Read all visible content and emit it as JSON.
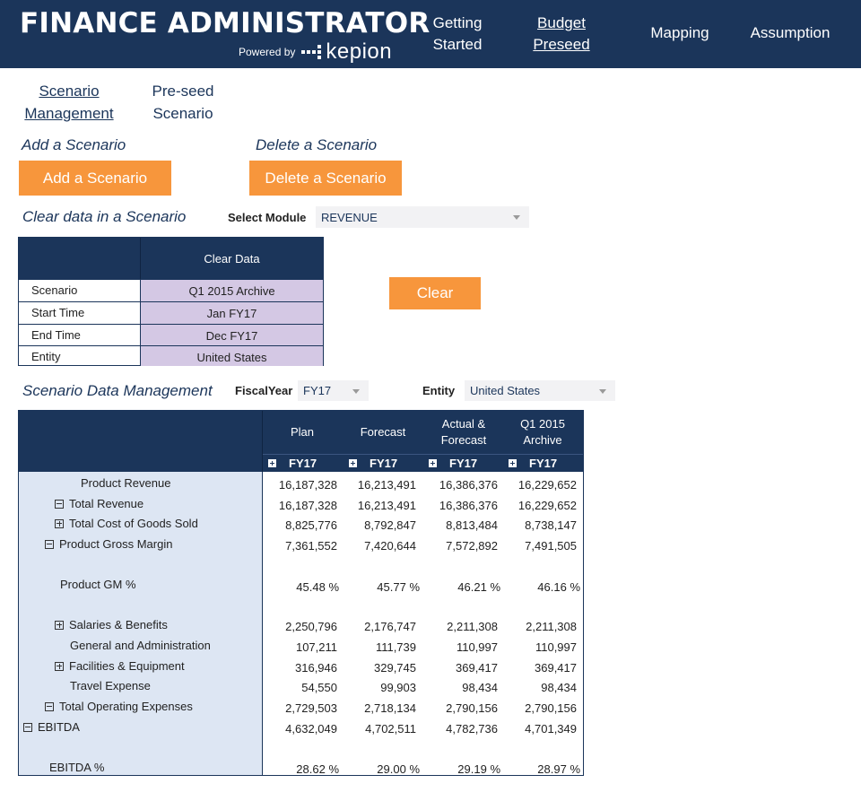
{
  "header": {
    "brand": "FINANCE ADMINISTRATOR",
    "powered_by": "Powered by",
    "logo_text": "kepion",
    "nav": [
      {
        "label_line1": "Getting",
        "label_line2": "Started"
      },
      {
        "label_line1": "Budget",
        "label_line2": "Preseed"
      },
      {
        "label": "Mapping"
      },
      {
        "label": "Assumption"
      }
    ],
    "bg_color": "#1b355a"
  },
  "sub_tabs": [
    {
      "line1": "Scenario",
      "line2": "Management"
    },
    {
      "line1": "Pre-seed",
      "line2": "Scenario"
    }
  ],
  "scenario_actions": {
    "add_title": "Add a Scenario",
    "add_button": "Add a Scenario",
    "delete_title": "Delete a Scenario",
    "delete_button": "Delete a Scenario",
    "accent_color": "#f7963c"
  },
  "clear_section": {
    "title": "Clear data in a Scenario",
    "module_label": "Select Module",
    "module_value": "REVENUE",
    "table_header": "Clear Data",
    "rows": [
      {
        "label": "Scenario",
        "value": "Q1 2015 Archive"
      },
      {
        "label": "Start Time",
        "value": "Jan FY17"
      },
      {
        "label": "End Time",
        "value": "Dec FY17"
      },
      {
        "label": "Entity",
        "value": "United States"
      }
    ],
    "clear_button": "Clear"
  },
  "data_mgmt": {
    "title": "Scenario Data Management",
    "fiscal_year_label": "FiscalYear",
    "fiscal_year_value": "FY17",
    "entity_label": "Entity",
    "entity_value": "United States",
    "columns": [
      {
        "line1": "Plan",
        "line2": "",
        "year": "FY17"
      },
      {
        "line1": "Forecast",
        "line2": "",
        "year": "FY17"
      },
      {
        "line1": "Actual &",
        "line2": "Forecast",
        "year": "FY17"
      },
      {
        "line1": "Q1 2015",
        "line2": "Archive",
        "year": "FY17"
      }
    ],
    "rows": [
      {
        "label": "Product Revenue",
        "values": [
          "16,187,328",
          "16,213,491",
          "16,386,376",
          "16,229,652"
        ]
      },
      {
        "label": "Total Revenue",
        "values": [
          "16,187,328",
          "16,213,491",
          "16,386,376",
          "16,229,652"
        ]
      },
      {
        "label": "Total Cost of Goods Sold",
        "values": [
          "8,825,776",
          "8,792,847",
          "8,813,484",
          "8,738,147"
        ]
      },
      {
        "label": "Product Gross Margin",
        "values": [
          "7,361,552",
          "7,420,644",
          "7,572,892",
          "7,491,505"
        ]
      },
      {
        "label": "Product GM %",
        "values": [
          "45.48 %",
          "45.77 %",
          "46.21 %",
          "46.16 %"
        ]
      },
      {
        "label": "Salaries & Benefits",
        "values": [
          "2,250,796",
          "2,176,747",
          "2,211,308",
          "2,211,308"
        ]
      },
      {
        "label": "General and Administration",
        "values": [
          "107,211",
          "111,739",
          "110,997",
          "110,997"
        ]
      },
      {
        "label": "Facilities & Equipment",
        "values": [
          "316,946",
          "329,745",
          "369,417",
          "369,417"
        ]
      },
      {
        "label": "Travel Expense",
        "values": [
          "54,550",
          "99,903",
          "98,434",
          "98,434"
        ]
      },
      {
        "label": "Total Operating Expenses",
        "values": [
          "2,729,503",
          "2,718,134",
          "2,790,156",
          "2,790,156"
        ]
      },
      {
        "label": "EBITDA",
        "values": [
          "4,632,049",
          "4,702,511",
          "4,782,736",
          "4,701,349"
        ]
      },
      {
        "label": "EBITDA %",
        "values": [
          "28.62 %",
          "29.00 %",
          "29.19 %",
          "28.97 %"
        ]
      }
    ]
  }
}
